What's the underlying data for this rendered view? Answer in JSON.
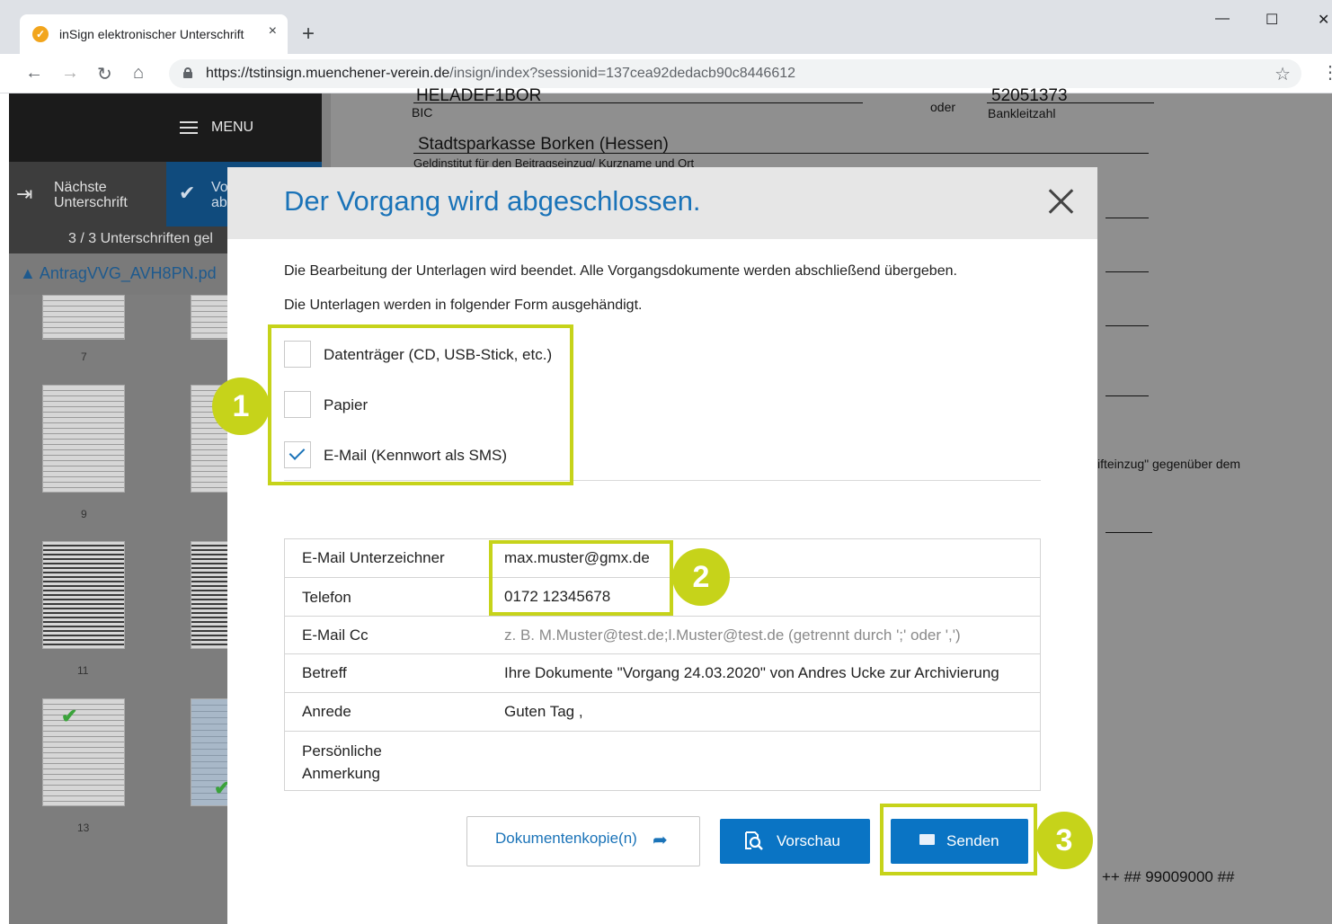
{
  "browser": {
    "tab_title": "inSign elektronischer Unterschrift",
    "tab_close": "×",
    "new_tab": "+",
    "url_host": "https://tstinsign.muenchener-verein.de",
    "url_path": "/insign/index?sessionid=137cea92dedacb90c8446612",
    "nav_back": "←",
    "nav_forward": "→",
    "nav_reload": "↻",
    "nav_home": "⌂",
    "bookmark": "☆",
    "more": "⋮",
    "win_min": "—",
    "win_max": "☐",
    "win_close": "✕"
  },
  "sidebar": {
    "menu_label": "MENU",
    "next_label_1": "Nächste",
    "next_label_2": "Unterschrift",
    "finish_label_1": "Vo",
    "finish_label_2": "ab",
    "signature_count": "3 / 3 Unterschriften gel",
    "file_name": "▲  AntragVVG_AVH8PN.pd",
    "thumb_numbers": [
      "7",
      "9",
      "11",
      "13"
    ]
  },
  "document": {
    "bic_value": "HELADEF1BOR",
    "bic_label": "BIC",
    "oder": "oder",
    "blz_value": "52051373",
    "blz_label": "Bankleitzahl",
    "bank_name": "Stadtsparkasse Borken (Hessen)",
    "bank_label": "Geldinstitut für den Beitragseinzug/ Kurzname und Ort",
    "text_fragment": "ifteinzug\" gegenüber dem",
    "footer_code": "++   ## 99009000 ##"
  },
  "modal": {
    "title": "Der Vorgang wird abgeschlossen.",
    "paragraph_1": "Die Bearbeitung der Unterlagen wird beendet. Alle Vorgangsdokumente werden abschließend übergeben.",
    "paragraph_2": "Die Unterlagen werden in folgender Form ausgehändigt.",
    "options": [
      {
        "label": "Datenträger (CD, USB-Stick, etc.)",
        "checked": false
      },
      {
        "label": "Papier",
        "checked": false
      },
      {
        "label": "E-Mail  (Kennwort als SMS)",
        "checked": true
      }
    ],
    "fields": [
      {
        "key": "E-Mail Unterzeichner",
        "value": "max.muster@gmx.de",
        "placeholder": false
      },
      {
        "key": "Telefon",
        "value": "0172 12345678",
        "placeholder": false
      },
      {
        "key": "E-Mail Cc",
        "value": "z. B. M.Muster@test.de;l.Muster@test.de (getrennt durch ';' oder ',')",
        "placeholder": true
      },
      {
        "key": "Betreff",
        "value": "Ihre Dokumente \"Vorgang 24.03.2020\" von Andres Ucke zur Archivierung",
        "placeholder": false
      },
      {
        "key": "Anrede",
        "value": "Guten Tag ,",
        "placeholder": false
      },
      {
        "key_1": "Persönliche",
        "key_2": "Anmerkung",
        "value": "",
        "placeholder": false
      }
    ],
    "buttons": {
      "copy": "Dokumentenkopie(n)",
      "preview": "Vorschau",
      "send": "Senden"
    }
  },
  "annotations": {
    "markers": [
      "1",
      "2",
      "3"
    ],
    "color": "#c6d31a"
  },
  "colors": {
    "accent_blue": "#0a74c4",
    "title_blue": "#1a73b8",
    "sidebar_active": "#104b7d"
  }
}
